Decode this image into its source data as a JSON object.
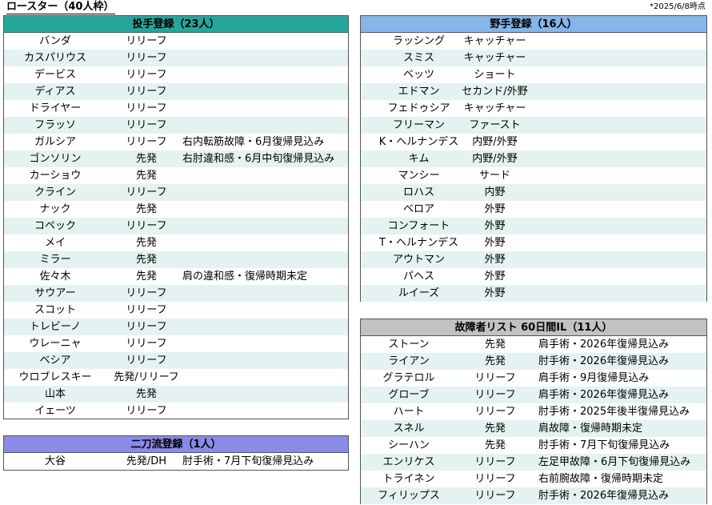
{
  "title": "ロースター（40人枠）",
  "as_of": "*2025/6/8時点",
  "pitchers": {
    "heading": "投手登録（23人）",
    "rows": [
      {
        "name": "バンダ",
        "role": "リリーフ",
        "status": ""
      },
      {
        "name": "カスパリウス",
        "role": "リリーフ",
        "status": ""
      },
      {
        "name": "デービス",
        "role": "リリーフ",
        "status": ""
      },
      {
        "name": "ディアス",
        "role": "リリーフ",
        "status": ""
      },
      {
        "name": "ドライヤー",
        "role": "リリーフ",
        "status": ""
      },
      {
        "name": "フラッソ",
        "role": "リリーフ",
        "status": ""
      },
      {
        "name": "ガルシア",
        "role": "リリーフ",
        "status": "右内転筋故障・6月復帰見込み"
      },
      {
        "name": "ゴンソリン",
        "role": "先発",
        "status": "右肘違和感・6月中旬復帰見込み"
      },
      {
        "name": "カーショウ",
        "role": "先発",
        "status": ""
      },
      {
        "name": "クライン",
        "role": "リリーフ",
        "status": ""
      },
      {
        "name": "ナック",
        "role": "先発",
        "status": ""
      },
      {
        "name": "コペック",
        "role": "リリーフ",
        "status": ""
      },
      {
        "name": "メイ",
        "role": "先発",
        "status": ""
      },
      {
        "name": "ミラー",
        "role": "先発",
        "status": ""
      },
      {
        "name": "佐々木",
        "role": "先発",
        "status": "肩の違和感・復帰時期未定"
      },
      {
        "name": "サウアー",
        "role": "リリーフ",
        "status": ""
      },
      {
        "name": "スコット",
        "role": "リリーフ",
        "status": ""
      },
      {
        "name": "トレビーノ",
        "role": "リリーフ",
        "status": ""
      },
      {
        "name": "ウレーニャ",
        "role": "リリーフ",
        "status": ""
      },
      {
        "name": "ベシア",
        "role": "リリーフ",
        "status": ""
      },
      {
        "name": "ウロブレスキー",
        "role": "先発/リリーフ",
        "status": ""
      },
      {
        "name": "山本",
        "role": "先発",
        "status": ""
      },
      {
        "name": "イェーツ",
        "role": "リリーフ",
        "status": ""
      }
    ]
  },
  "fielders": {
    "heading": "野手登録（16人）",
    "rows": [
      {
        "name": "ラッシング",
        "pos": "キャッチャー"
      },
      {
        "name": "スミス",
        "pos": "キャッチャー"
      },
      {
        "name": "ベッツ",
        "pos": "ショート"
      },
      {
        "name": "エドマン",
        "pos": "セカンド/外野"
      },
      {
        "name": "フェドゥシア",
        "pos": "キャッチャー"
      },
      {
        "name": "フリーマン",
        "pos": "ファースト"
      },
      {
        "name": "K・ヘルナンデス",
        "pos": "内野/外野"
      },
      {
        "name": "キム",
        "pos": "内野/外野"
      },
      {
        "name": "マンシー",
        "pos": "サード"
      },
      {
        "name": "ロハス",
        "pos": "内野"
      },
      {
        "name": "ベロア",
        "pos": "外野"
      },
      {
        "name": "コンフォート",
        "pos": "外野"
      },
      {
        "name": "T・ヘルナンデス",
        "pos": "外野"
      },
      {
        "name": "アウトマン",
        "pos": "外野"
      },
      {
        "name": "パヘス",
        "pos": "外野"
      },
      {
        "name": "ルイーズ",
        "pos": "外野"
      }
    ]
  },
  "twoway": {
    "heading": "二刀流登録（1人）",
    "rows": [
      {
        "name": "大谷",
        "role": "先発/DH",
        "status": "肘手術・7月下旬復帰見込み"
      }
    ]
  },
  "injured": {
    "heading": "故障者リスト 60日間IL（11人）",
    "rows": [
      {
        "name": "ストーン",
        "role": "先発",
        "status": "肩手術・2026年復帰見込み"
      },
      {
        "name": "ライアン",
        "role": "先発",
        "status": "肘手術・2026年復帰見込み"
      },
      {
        "name": "グラテロル",
        "role": "リリーフ",
        "status": "肩手術・9月復帰見込み"
      },
      {
        "name": "グローブ",
        "role": "リリーフ",
        "status": "肩手術・2026年復帰見込み"
      },
      {
        "name": "ハート",
        "role": "リリーフ",
        "status": "肘手術・2025年後半復帰見込み"
      },
      {
        "name": "スネル",
        "role": "先発",
        "status": "肩故障・復帰時期未定"
      },
      {
        "name": "シーハン",
        "role": "先発",
        "status": "肘手術・7月下旬復帰見込み"
      },
      {
        "name": "エンリケス",
        "role": "リリーフ",
        "status": "左足甲故障・6月下旬復帰見込み"
      },
      {
        "name": "トライネン",
        "role": "リリーフ",
        "status": "右前腕故障・復帰時期未定"
      },
      {
        "name": "フィリップス",
        "role": "リリーフ",
        "status": "肘手術・2026年復帰見込み"
      }
    ]
  }
}
